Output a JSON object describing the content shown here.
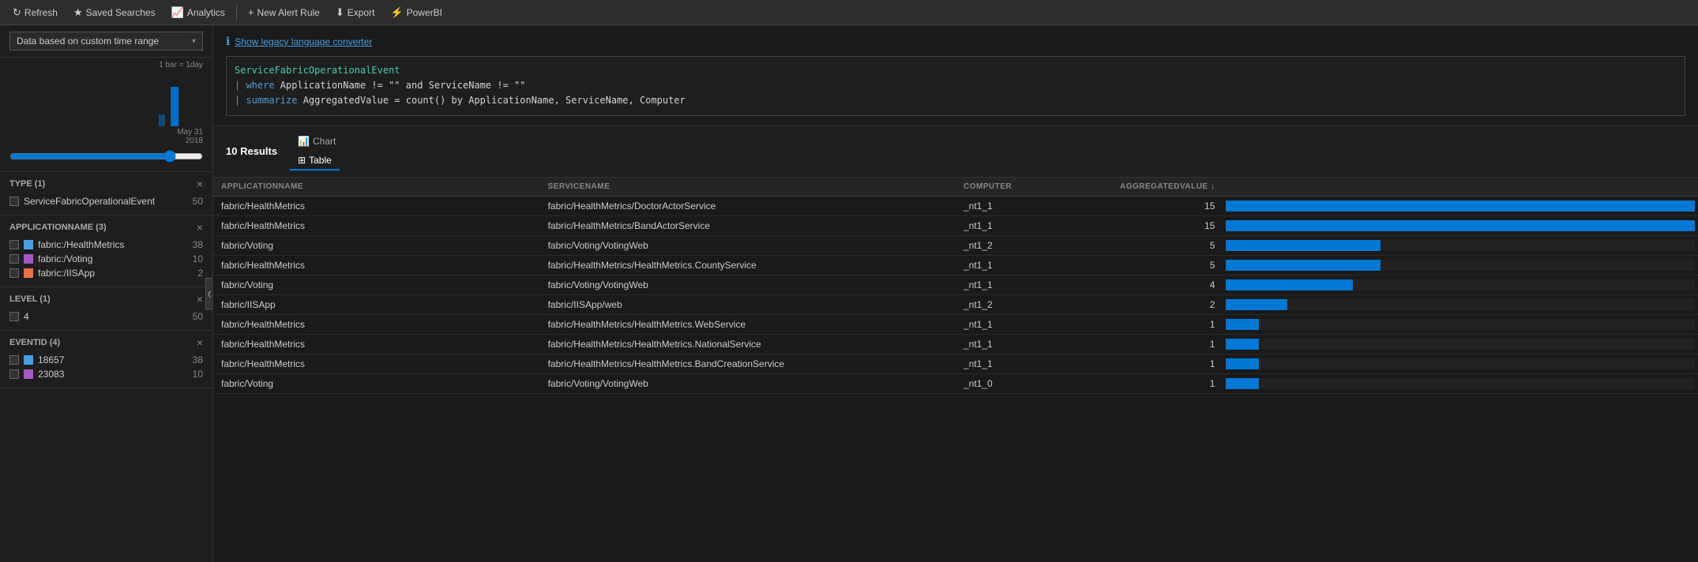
{
  "toolbar": {
    "refresh_label": "Refresh",
    "saved_searches_label": "Saved Searches",
    "analytics_label": "Analytics",
    "new_alert_label": "New Alert Rule",
    "export_label": "Export",
    "powerbi_label": "PowerBI"
  },
  "sidebar": {
    "time_range_label": "Data based on custom time range",
    "chart_scale": "1 bar = 1day",
    "chart_date": "May 31\n2018",
    "filters": [
      {
        "id": "type",
        "title": "TYPE (1)",
        "items": [
          {
            "label": "ServiceFabricOperationalEvent",
            "count": 50,
            "color": null
          }
        ]
      },
      {
        "id": "applicationname",
        "title": "APPLICATIONNAME (3)",
        "items": [
          {
            "label": "fabric:/HealthMetrics",
            "count": 38,
            "color": "#4a9fe0"
          },
          {
            "label": "fabric:/Voting",
            "count": 10,
            "color": "#a259c4"
          },
          {
            "label": "fabric:/IISApp",
            "count": 2,
            "color": "#e8734a"
          }
        ]
      },
      {
        "id": "level",
        "title": "LEVEL (1)",
        "items": [
          {
            "label": "4",
            "count": 50,
            "color": null
          }
        ]
      },
      {
        "id": "eventid",
        "title": "EVENTID (4)",
        "items": [
          {
            "label": "18657",
            "count": 38,
            "color": "#4a9fe0"
          },
          {
            "label": "23083",
            "count": 10,
            "color": "#a259c4"
          }
        ]
      }
    ]
  },
  "query_area": {
    "legacy_text": "Show legacy language converter",
    "query_line1": "ServiceFabricOperationalEvent",
    "query_line2": "| where ApplicationName != \"\" and ServiceName != \"\"",
    "query_line3": "| summarize AggregatedValue = count() by ApplicationName, ServiceName, Computer"
  },
  "results": {
    "count": "10",
    "label": "Results",
    "tabs": [
      {
        "id": "chart",
        "label": "Chart",
        "icon": "📊",
        "active": false
      },
      {
        "id": "table",
        "label": "Table",
        "icon": "⊞",
        "active": true
      }
    ],
    "columns": [
      {
        "id": "applicationname",
        "label": "APPLICATIONNAME"
      },
      {
        "id": "servicename",
        "label": "SERVICENAME"
      },
      {
        "id": "computer",
        "label": "COMPUTER"
      },
      {
        "id": "aggregatedvalue",
        "label": "AGGREGATEDVALUE ↓"
      },
      {
        "id": "bar",
        "label": ""
      }
    ],
    "rows": [
      {
        "applicationname": "fabric/HealthMetrics",
        "servicename": "fabric/HealthMetrics/DoctorActorService",
        "computer": "_nt1_1",
        "aggregatedvalue": 15,
        "bar_pct": 100
      },
      {
        "applicationname": "fabric/HealthMetrics",
        "servicename": "fabric/HealthMetrics/BandActorService",
        "computer": "_nt1_1",
        "aggregatedvalue": 15,
        "bar_pct": 100
      },
      {
        "applicationname": "fabric/Voting",
        "servicename": "fabric/Voting/VotingWeb",
        "computer": "_nt1_2",
        "aggregatedvalue": 5,
        "bar_pct": 33
      },
      {
        "applicationname": "fabric/HealthMetrics",
        "servicename": "fabric/HealthMetrics/HealthMetrics.CountyService",
        "computer": "_nt1_1",
        "aggregatedvalue": 5,
        "bar_pct": 33
      },
      {
        "applicationname": "fabric/Voting",
        "servicename": "fabric/Voting/VotingWeb",
        "computer": "_nt1_1",
        "aggregatedvalue": 4,
        "bar_pct": 27
      },
      {
        "applicationname": "fabric/IISApp",
        "servicename": "fabric/IISApp/web",
        "computer": "_nt1_2",
        "aggregatedvalue": 2,
        "bar_pct": 13
      },
      {
        "applicationname": "fabric/HealthMetrics",
        "servicename": "fabric/HealthMetrics/HealthMetrics.WebService",
        "computer": "_nt1_1",
        "aggregatedvalue": 1,
        "bar_pct": 7
      },
      {
        "applicationname": "fabric/HealthMetrics",
        "servicename": "fabric/HealthMetrics/HealthMetrics.NationalService",
        "computer": "_nt1_1",
        "aggregatedvalue": 1,
        "bar_pct": 7
      },
      {
        "applicationname": "fabric/HealthMetrics",
        "servicename": "fabric/HealthMetrics/HealthMetrics.BandCreationService",
        "computer": "_nt1_1",
        "aggregatedvalue": 1,
        "bar_pct": 7
      },
      {
        "applicationname": "fabric/Voting",
        "servicename": "fabric/Voting/VotingWeb",
        "computer": "_nt1_0",
        "aggregatedvalue": 1,
        "bar_pct": 7
      }
    ],
    "max_bar_value": 15
  }
}
